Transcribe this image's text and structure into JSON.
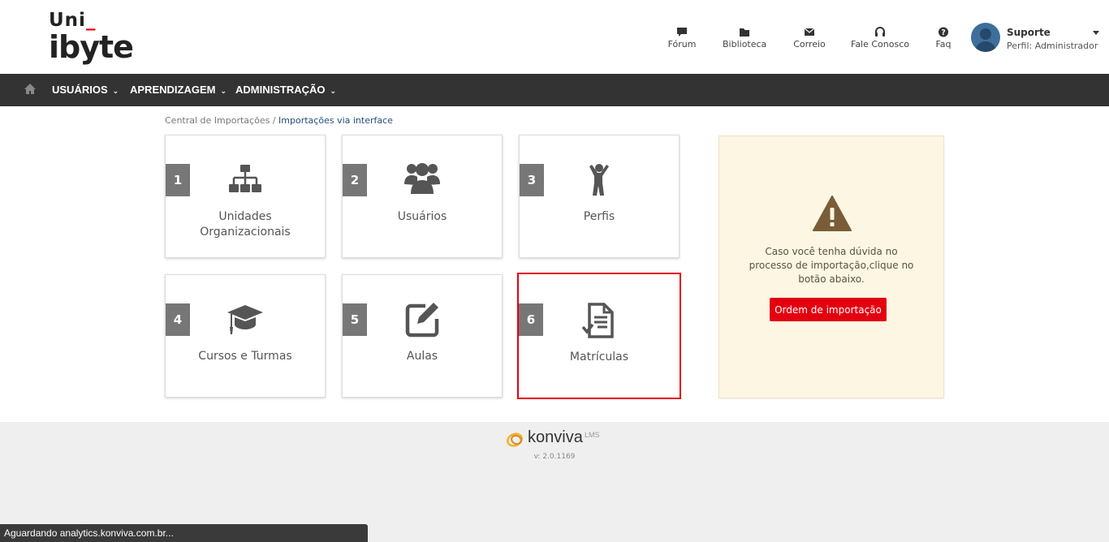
{
  "brand": {
    "logo_line1": "Uni",
    "logo_line1_mark": "_",
    "logo_line2": "ibyte"
  },
  "toplinks": [
    {
      "label": "Fórum",
      "icon": "chat-icon"
    },
    {
      "label": "Biblioteca",
      "icon": "folder-icon"
    },
    {
      "label": "Correio",
      "icon": "envelope-icon"
    },
    {
      "label": "Fale Conosco",
      "icon": "headset-icon"
    },
    {
      "label": "Faq",
      "icon": "question-circle-icon"
    }
  ],
  "user": {
    "name": "Suporte",
    "role": "Perfil: Administrador"
  },
  "nav": {
    "items": [
      {
        "label": "USUÁRIOS"
      },
      {
        "label": "APRENDIZAGEM"
      },
      {
        "label": "ADMINISTRAÇÃO"
      }
    ]
  },
  "breadcrumb": {
    "parent": "Central de Importações",
    "separator": "/",
    "current": "Importações via interface"
  },
  "cards": [
    {
      "number": "1",
      "label": "Unidades Organizacionais",
      "icon": "org-chart-icon"
    },
    {
      "number": "2",
      "label": "Usuários",
      "icon": "users-icon"
    },
    {
      "number": "3",
      "label": "Perfis",
      "icon": "person-icon"
    },
    {
      "number": "4",
      "label": "Cursos e Turmas",
      "icon": "graduation-cap-icon"
    },
    {
      "number": "5",
      "label": "Aulas",
      "icon": "edit-icon"
    },
    {
      "number": "6",
      "label": "Matrículas",
      "icon": "document-check-icon",
      "selected": true
    }
  ],
  "info": {
    "text": "Caso você tenha dúvida no processo de importação,clique no botão abaixo.",
    "button": "Ordem de importação"
  },
  "footer": {
    "brand": "konviva",
    "brand_suffix": "LMS",
    "version": "v: 2.0.1169"
  },
  "status_bar": "Aguardando analytics.konviva.com.br...",
  "colors": {
    "accent": "#e3000f",
    "navbar": "#333333",
    "info_bg": "#fcf6e3",
    "number_badge": "#777777"
  }
}
